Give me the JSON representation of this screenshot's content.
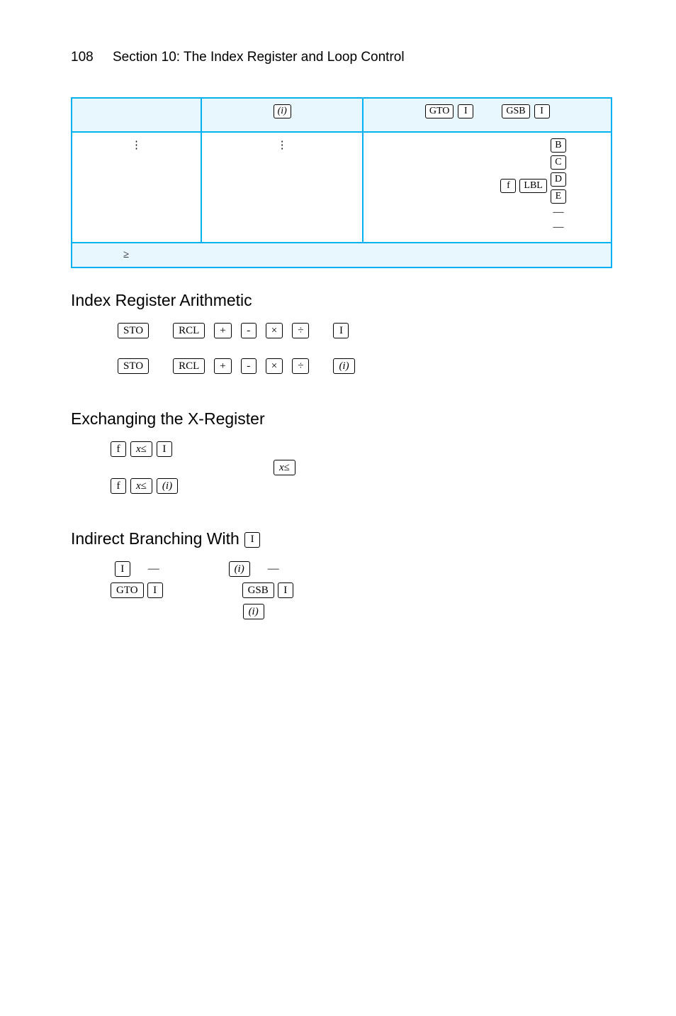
{
  "page": {
    "number": "108",
    "section": "Section 10: The Index Register and Loop Control"
  },
  "keys": {
    "GTO": "GTO",
    "GSB": "GSB",
    "I": "I",
    "i": "(i)",
    "f": "f",
    "LBL": "LBL",
    "B": "B",
    "C": "C",
    "D": "D",
    "E": "E",
    "STO": "STO",
    "RCL": "RCL",
    "plus": "+",
    "minus": "-",
    "times": "×",
    "div": "÷",
    "xswap": "x⤳"
  },
  "table": {
    "geq": "≥",
    "emdash": "—",
    "vdots": "⋮"
  },
  "headings": {
    "h1": "Index Register Arithmetic",
    "h2": "Exchanging the X-Register",
    "h3_pre": "Indirect Branching With "
  }
}
